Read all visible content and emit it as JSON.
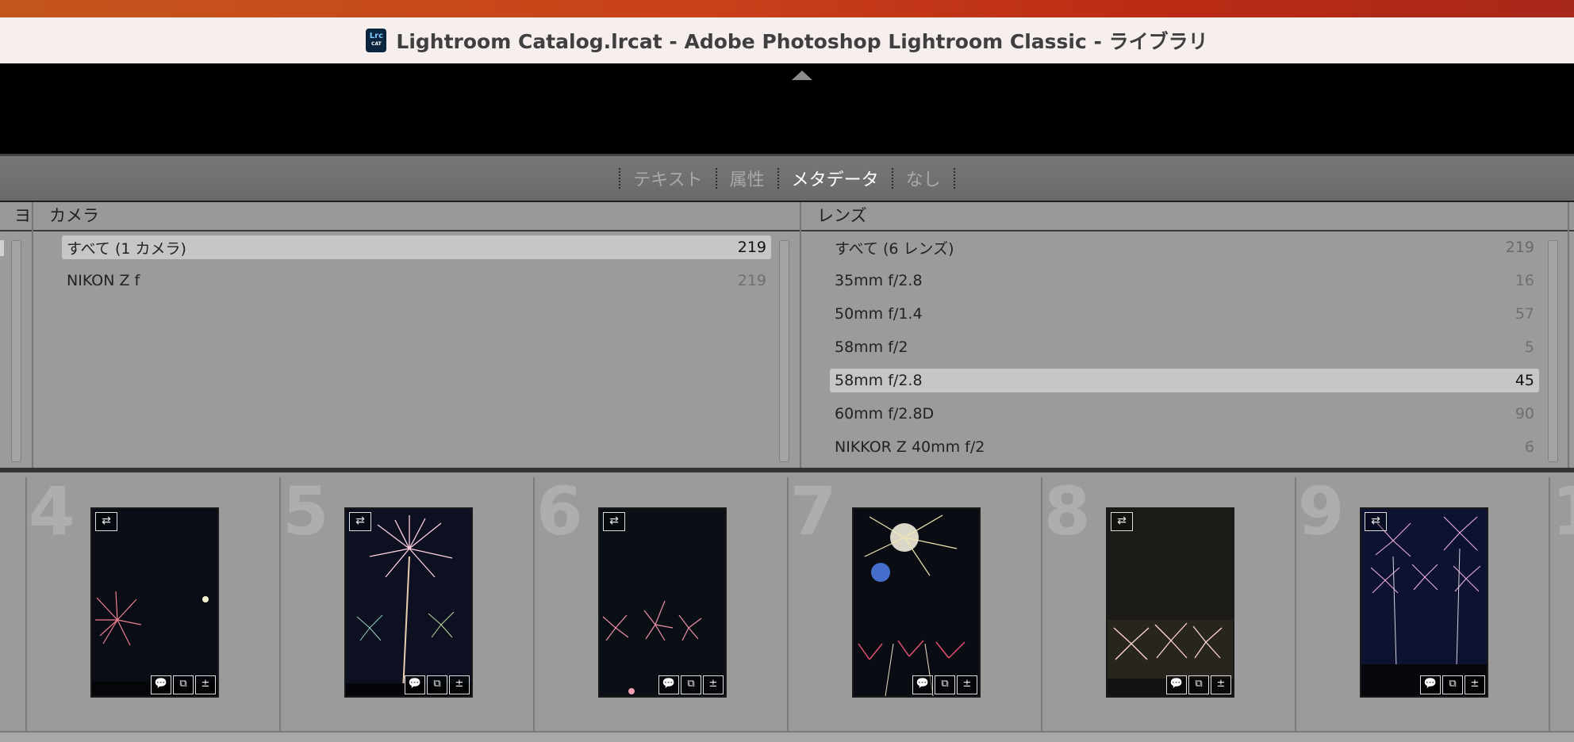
{
  "window": {
    "app_icon_text": "Lrc",
    "app_icon_sub": "CAT",
    "title": "Lightroom Catalog.lrcat - Adobe Photoshop Lightroom Classic - ライブラリ"
  },
  "filter_bar": {
    "tabs": [
      {
        "label": "テキスト",
        "active": false
      },
      {
        "label": "属性",
        "active": false
      },
      {
        "label": "メタデータ",
        "active": true
      },
      {
        "label": "なし",
        "active": false
      }
    ]
  },
  "metadata_browser": {
    "left_edge_glyph": "ヨ",
    "camera_column": {
      "header": "カメラ",
      "items": [
        {
          "label": "すべて (1 カメラ)",
          "count": "219",
          "selected": true
        },
        {
          "label": "NIKON Z f",
          "count": "219",
          "selected": false
        }
      ]
    },
    "lens_column": {
      "header": "レンズ",
      "items": [
        {
          "label": "すべて (6 レンズ)",
          "count": "219",
          "selected": false
        },
        {
          "label": "35mm f/2.8",
          "count": "16",
          "selected": false
        },
        {
          "label": "50mm f/1.4",
          "count": "57",
          "selected": false
        },
        {
          "label": "58mm f/2",
          "count": "5",
          "selected": false
        },
        {
          "label": "58mm f/2.8",
          "count": "45",
          "selected": true
        },
        {
          "label": "60mm f/2.8D",
          "count": "90",
          "selected": false
        },
        {
          "label": "NIKKOR Z 40mm f/2",
          "count": "6",
          "selected": false
        }
      ]
    }
  },
  "filmstrip": {
    "cells": [
      {
        "number": "4",
        "badge": "⇄",
        "scene": "pink-burst-moon"
      },
      {
        "number": "5",
        "badge": "⇄",
        "scene": "tall-white-burst"
      },
      {
        "number": "6",
        "badge": "⇄",
        "scene": "low-pink-bursts"
      },
      {
        "number": "7",
        "badge": "",
        "scene": "white-blue-burst"
      },
      {
        "number": "8",
        "badge": "⇄",
        "scene": "low-white-bursts"
      },
      {
        "number": "9",
        "badge": "⇄",
        "scene": "many-pink-bursts"
      },
      {
        "number": "1",
        "badge": "",
        "scene": "partial"
      }
    ],
    "cell_icons": [
      "💬",
      "⧉",
      "±"
    ]
  }
}
